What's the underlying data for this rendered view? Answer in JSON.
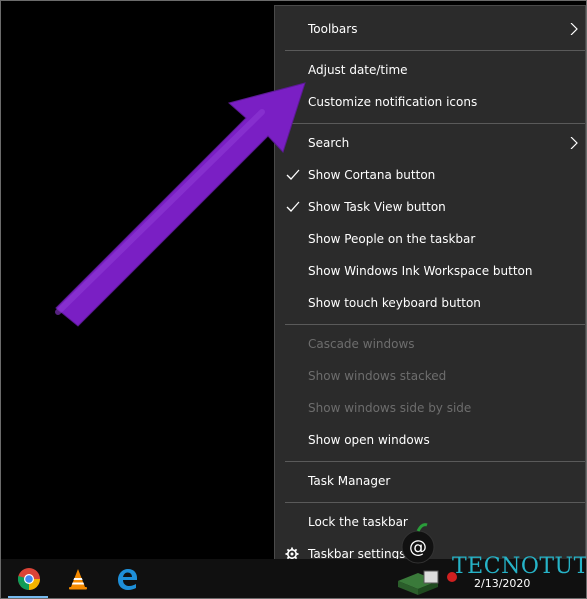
{
  "menu": {
    "items": [
      {
        "label": "Toolbars",
        "submenu": true
      },
      {
        "label": "Adjust date/time"
      },
      {
        "label": "Customize notification icons"
      },
      {
        "label": "Search",
        "submenu": true
      },
      {
        "label": "Show Cortana button",
        "checked": true
      },
      {
        "label": "Show Task View button",
        "checked": true
      },
      {
        "label": "Show People on the taskbar"
      },
      {
        "label": "Show Windows Ink Workspace button"
      },
      {
        "label": "Show touch keyboard button"
      },
      {
        "label": "Cascade windows",
        "disabled": true
      },
      {
        "label": "Show windows stacked",
        "disabled": true
      },
      {
        "label": "Show windows side by side",
        "disabled": true
      },
      {
        "label": "Show open windows"
      },
      {
        "label": "Task Manager"
      },
      {
        "label": "Lock the taskbar"
      },
      {
        "label": "Taskbar settings",
        "icon": "gear-icon"
      }
    ]
  },
  "taskbar": {
    "pinned": [
      {
        "name": "chrome-icon"
      },
      {
        "name": "vlc-icon"
      },
      {
        "name": "edge-icon"
      }
    ],
    "clock_date": "2/13/2020"
  },
  "watermark": {
    "text": "TECNOTUTO"
  },
  "colors": {
    "menu_bg": "#2b2b2b",
    "arrow": "#7a1fc4",
    "accent": "#76b9ed"
  }
}
